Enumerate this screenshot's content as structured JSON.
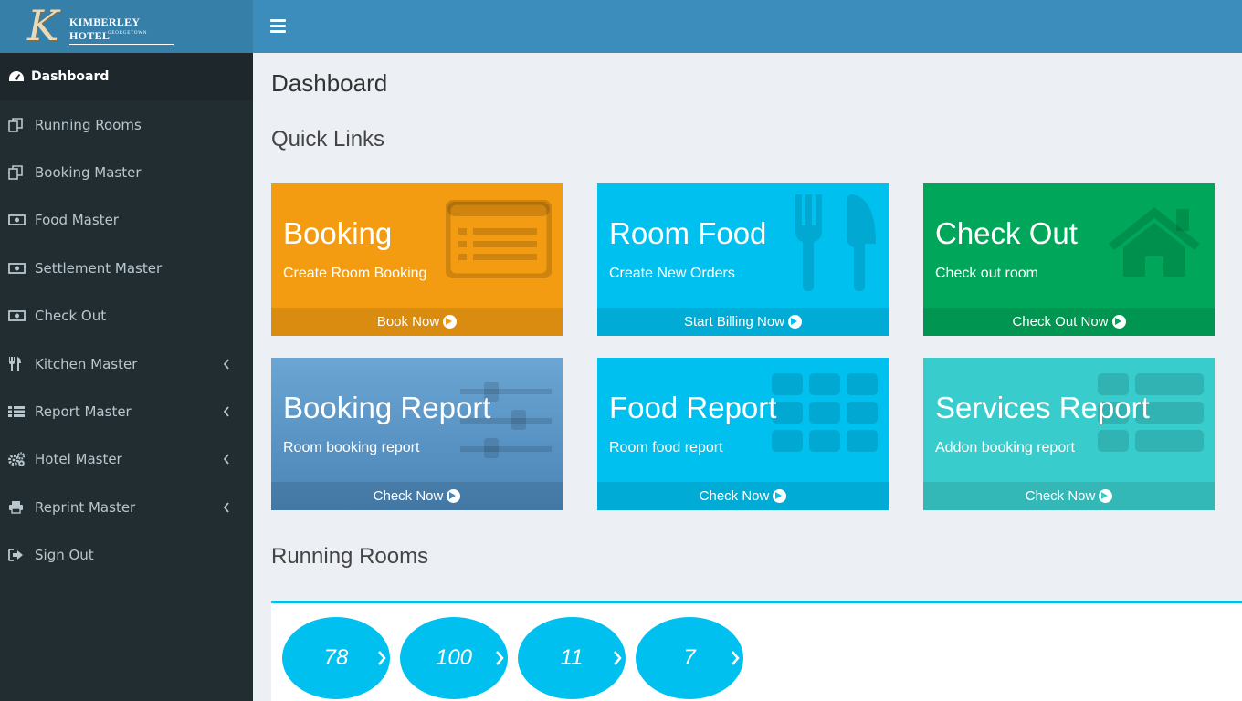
{
  "brand": {
    "initial": "K",
    "name": "KIMBERLEY HOTEL",
    "location": "GEORGETOWN"
  },
  "sidebar": {
    "items": [
      {
        "label": "Dashboard",
        "icon": "dashboard-icon",
        "active": true
      },
      {
        "label": "Running Rooms",
        "icon": "copy-icon"
      },
      {
        "label": "Booking Master",
        "icon": "copy-icon"
      },
      {
        "label": "Food Master",
        "icon": "money-icon"
      },
      {
        "label": "Settlement Master",
        "icon": "money-icon"
      },
      {
        "label": "Check Out",
        "icon": "money-icon"
      },
      {
        "label": "Kitchen Master",
        "icon": "cutlery-icon",
        "submenu": true
      },
      {
        "label": "Report Master",
        "icon": "list-icon",
        "submenu": true
      },
      {
        "label": "Hotel Master",
        "icon": "cogs-icon",
        "submenu": true
      },
      {
        "label": "Reprint Master",
        "icon": "print-icon",
        "submenu": true
      },
      {
        "label": "Sign Out",
        "icon": "sign-out-icon"
      }
    ]
  },
  "main": {
    "page_title": "Dashboard",
    "quick_links_title": "Quick Links",
    "running_rooms_title": "Running Rooms",
    "tiles": [
      {
        "title": "Booking",
        "subtitle": "Create Room Booking",
        "footer": "Book Now",
        "color": "#f39c12",
        "icon": "list-alt-icon"
      },
      {
        "title": "Room Food",
        "subtitle": "Create New Orders",
        "footer": "Start Billing Now",
        "color": "#00c0ef",
        "icon": "cutlery-icon"
      },
      {
        "title": "Check Out",
        "subtitle": "Check out room",
        "footer": "Check Out Now",
        "color": "#00a65a",
        "icon": "home-icon"
      },
      {
        "title": "Booking Report",
        "subtitle": "Room booking report",
        "footer": "Check Now",
        "color": "#5b97c9",
        "icon": "sliders-icon"
      },
      {
        "title": "Food Report",
        "subtitle": "Room food report",
        "footer": "Check Now",
        "color": "#00c0ef",
        "icon": "th-icon"
      },
      {
        "title": "Services Report",
        "subtitle": "Addon booking report",
        "footer": "Check Now",
        "color": "#39cccc",
        "icon": "th-list-icon"
      }
    ],
    "rooms": [
      "78",
      "100",
      "11",
      "7"
    ]
  }
}
